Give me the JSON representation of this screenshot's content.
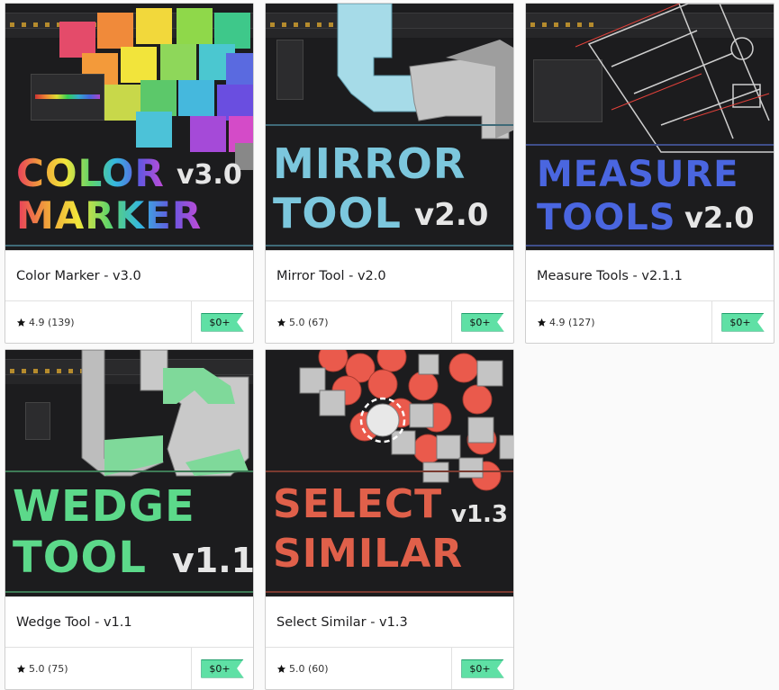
{
  "products": [
    {
      "id": "color-marker",
      "title": "Color Marker - v3.0",
      "rating": "4.9",
      "reviews": "(139)",
      "price": "$0+",
      "banner": {
        "line1": "COLOR",
        "line2": "MARKER",
        "version": "v3.0"
      }
    },
    {
      "id": "mirror-tool",
      "title": "Mirror Tool - v2.0",
      "rating": "5.0",
      "reviews": "(67)",
      "price": "$0+",
      "banner": {
        "line1": "MIRROR",
        "line2": "TOOL",
        "version": "v2.0"
      }
    },
    {
      "id": "measure-tools",
      "title": "Measure Tools - v2.1.1",
      "rating": "4.9",
      "reviews": "(127)",
      "price": "$0+",
      "banner": {
        "line1": "MEASURE",
        "line2": "TOOLS",
        "version": "v2.0"
      }
    },
    {
      "id": "wedge-tool",
      "title": "Wedge Tool - v1.1",
      "rating": "5.0",
      "reviews": "(75)",
      "price": "$0+",
      "banner": {
        "line1": "WEDGE",
        "line2": "TOOL",
        "version": "v1.1"
      }
    },
    {
      "id": "select-similar",
      "title": "Select Similar - v1.3",
      "rating": "5.0",
      "reviews": "(60)",
      "price": "$0+",
      "banner": {
        "line1": "SELECT",
        "line2": "SIMILAR",
        "version": "v1.3"
      }
    }
  ],
  "colors": {
    "price_badge": "#5fe0a5",
    "mirror_text": "#7cc7dd",
    "measure_text": "#4a66e0",
    "wedge_text": "#5cd98a",
    "select_text": "#e0604a"
  }
}
